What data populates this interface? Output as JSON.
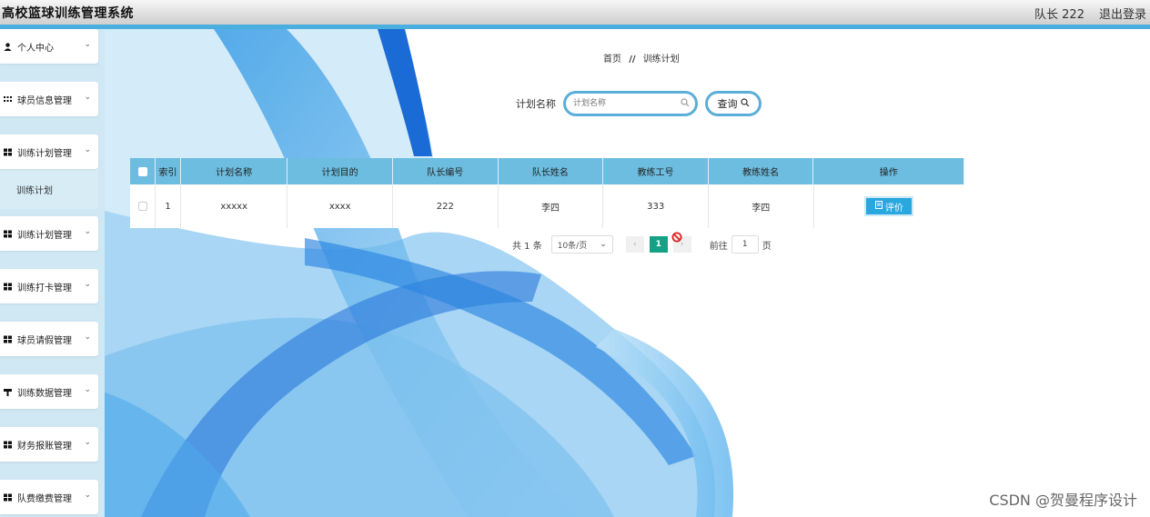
{
  "header": {
    "app_title": "高校篮球训练管理系统",
    "user_label": "队长 222",
    "logout_label": "退出登录"
  },
  "sidebar": {
    "items": [
      {
        "label": "个人中心",
        "icon": "user-icon"
      },
      {
        "label": "球员信息管理",
        "icon": "grid-icon"
      },
      {
        "label": "训练计划管理",
        "icon": "grid-icon"
      },
      {
        "label": "训练计划",
        "icon": "",
        "sub": true
      },
      {
        "label": "训练计划管理",
        "icon": "grid-icon"
      },
      {
        "label": "训练打卡管理",
        "icon": "grid-icon"
      },
      {
        "label": "球员请假管理",
        "icon": "grid-icon"
      },
      {
        "label": "训练数据管理",
        "icon": "flag-icon"
      },
      {
        "label": "财务报账管理",
        "icon": "grid-icon"
      },
      {
        "label": "队费缴费管理",
        "icon": "grid-icon"
      }
    ]
  },
  "breadcrumb": {
    "home": "首页",
    "separator": "//",
    "current": "训练计划"
  },
  "search": {
    "label": "计划名称",
    "placeholder": "计划名称",
    "button_label": "查询"
  },
  "table": {
    "headers": [
      "索引",
      "计划名称",
      "计划目的",
      "队长编号",
      "队长姓名",
      "教练工号",
      "教练姓名",
      "操作"
    ],
    "rows": [
      {
        "index": "1",
        "plan_name": "xxxxx",
        "plan_goal": "xxxx",
        "captain_no": "222",
        "captain_name": "李四",
        "coach_no": "333",
        "coach_name": "李四",
        "action": "评价"
      }
    ]
  },
  "pagination": {
    "total": "共 1 条",
    "page_size": "10条/页",
    "current_page": "1",
    "goto_label": "前往",
    "goto_value": "1",
    "page_unit": "页"
  },
  "watermark": "CSDN @贺曼程序设计",
  "colors": {
    "accent": "#4aaede",
    "table_header": "#6cbde0",
    "button": "#29a8e0",
    "page_active": "#16a085"
  }
}
